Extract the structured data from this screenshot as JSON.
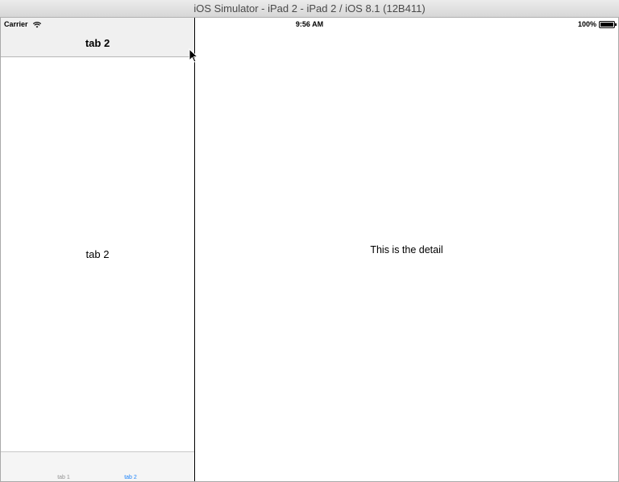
{
  "window": {
    "title": "iOS Simulator - iPad 2 - iPad 2 / iOS 8.1 (12B411)"
  },
  "status_bar": {
    "carrier": "Carrier",
    "time": "9:56 AM",
    "battery": "100%",
    "battery_level": 1.0
  },
  "master": {
    "nav_title": "tab 2",
    "content_label": "tab 2",
    "tabs": [
      {
        "label": "tab 1",
        "selected": false
      },
      {
        "label": "tab 2",
        "selected": true
      }
    ]
  },
  "detail": {
    "label": "This is the detail"
  },
  "colors": {
    "tab_selected": "#1a82fb",
    "tab_unselected": "#929292"
  }
}
